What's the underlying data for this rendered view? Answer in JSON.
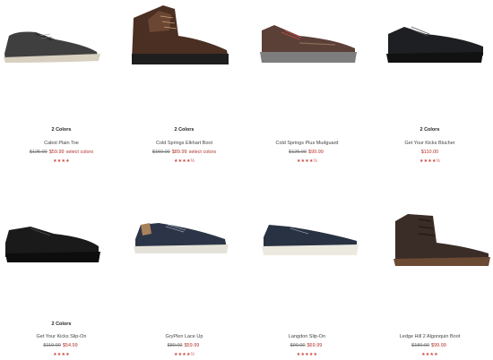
{
  "products": [
    {
      "colors": "2 Colors",
      "name": "Cabot Plain Toe",
      "old": "$125.00",
      "new": "$59.99",
      "note": "select colors",
      "stars": "★★★★",
      "shoe": "gray-oxford"
    },
    {
      "colors": "2 Colors",
      "name": "Cold Springs Elkhart Boot",
      "old": "$150.00",
      "new": "$89.99",
      "note": "select colors",
      "stars": "★★★★½",
      "shoe": "brown-boot"
    },
    {
      "colors": "",
      "name": "Cold Springs Plus Mudguard",
      "old": "$125.00",
      "new": "$99.99",
      "note": "",
      "stars": "★★★★½",
      "shoe": "brown-hiker"
    },
    {
      "colors": "2 Colors",
      "name": "Get Your Kicks Blucher",
      "old": "",
      "new": "$110.00",
      "note": "",
      "stars": "★★★★½",
      "shoe": "black-sneaker"
    },
    {
      "colors": "2 Colors",
      "name": "Get Your Kicks Slip-On",
      "old": "$110.00",
      "new": "$54.99",
      "note": "",
      "stars": "★★★★",
      "shoe": "black-slipon"
    },
    {
      "colors": "",
      "name": "GryPlen Lace Up",
      "old": "$80.00",
      "new": "$59.99",
      "note": "",
      "stars": "★★★★½",
      "shoe": "navy-laceup"
    },
    {
      "colors": "",
      "name": "Langdon Slip-On",
      "old": "$90.00",
      "new": "$69.99",
      "note": "",
      "stars": "★★★★★",
      "shoe": "navy-slipon"
    },
    {
      "colors": "",
      "name": "Ledge Hill 2 Algonquin Boot",
      "old": "$180.00",
      "new": "$99.99",
      "note": "",
      "stars": "★★★★",
      "shoe": "dark-chukka"
    }
  ]
}
